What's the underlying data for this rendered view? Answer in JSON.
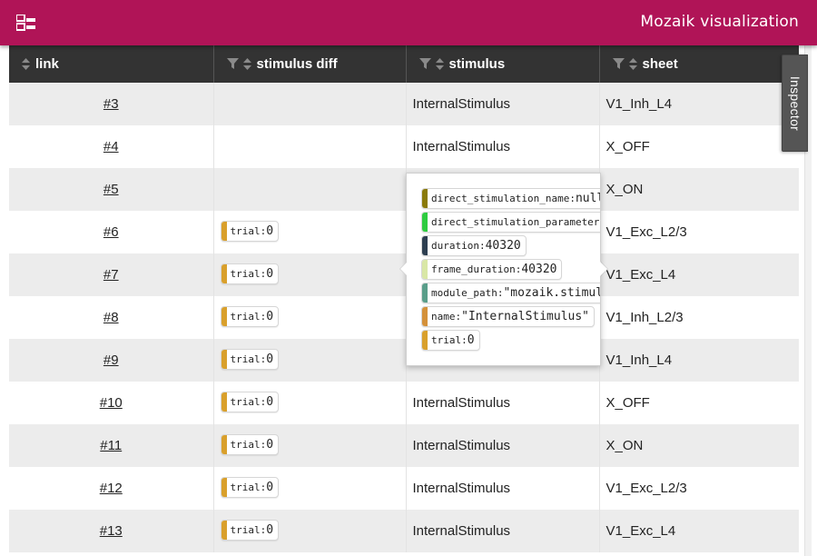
{
  "header": {
    "title": "Mozaik visualization",
    "icon": "layout-tree-icon"
  },
  "colors": {
    "header_bg": "#b01457",
    "table_header_bg": "#333333",
    "row_alt": "#ececec"
  },
  "inspector": {
    "label": "Inspector"
  },
  "columns": [
    {
      "label": "link",
      "filter": false
    },
    {
      "label": "stimulus diff",
      "filter": true
    },
    {
      "label": "stimulus",
      "filter": true
    },
    {
      "label": "sheet",
      "filter": true
    }
  ],
  "rows": [
    {
      "link": "#3",
      "diff": null,
      "stimulus": "InternalStimulus",
      "sheet": "V1_Inh_L4"
    },
    {
      "link": "#4",
      "diff": null,
      "stimulus": "InternalStimulus",
      "sheet": "X_OFF"
    },
    {
      "link": "#5",
      "diff": null,
      "stimulus": "",
      "sheet": "X_ON"
    },
    {
      "link": "#6",
      "diff": {
        "key": "trial:",
        "value": "0"
      },
      "stimulus": "",
      "sheet": "V1_Exc_L2/3"
    },
    {
      "link": "#7",
      "diff": {
        "key": "trial:",
        "value": "0"
      },
      "stimulus": "",
      "sheet": "V1_Exc_L4"
    },
    {
      "link": "#8",
      "diff": {
        "key": "trial:",
        "value": "0"
      },
      "stimulus": "",
      "sheet": "V1_Inh_L2/3"
    },
    {
      "link": "#9",
      "diff": {
        "key": "trial:",
        "value": "0"
      },
      "stimulus": "",
      "sheet": "V1_Inh_L4"
    },
    {
      "link": "#10",
      "diff": {
        "key": "trial:",
        "value": "0"
      },
      "stimulus": "InternalStimulus",
      "sheet": "X_OFF"
    },
    {
      "link": "#11",
      "diff": {
        "key": "trial:",
        "value": "0"
      },
      "stimulus": "InternalStimulus",
      "sheet": "X_ON"
    },
    {
      "link": "#12",
      "diff": {
        "key": "trial:",
        "value": "0"
      },
      "stimulus": "InternalStimulus",
      "sheet": "V1_Exc_L2/3"
    },
    {
      "link": "#13",
      "diff": {
        "key": "trial:",
        "value": "0"
      },
      "stimulus": "InternalStimulus",
      "sheet": "V1_Exc_L4"
    }
  ],
  "popup": {
    "items": [
      {
        "key": "direct_stimulation_name:",
        "value": "null",
        "color": "#8a7a0a"
      },
      {
        "key": "direct_stimulation_parameters:",
        "value": "",
        "color": "#2ecc40"
      },
      {
        "key": "duration:",
        "value": "40320",
        "color": "#2d3e50"
      },
      {
        "key": "frame_duration:",
        "value": "40320",
        "color": "#d9e7a6"
      },
      {
        "key": "module_path:",
        "value": "\"mozaik.stimuli\"",
        "color": "#5a9e8a"
      },
      {
        "key": "name:",
        "value": "\"InternalStimulus\"",
        "color": "#d4913a"
      },
      {
        "key": "trial:",
        "value": "0",
        "color": "#d9a02c"
      }
    ]
  },
  "trial_color": "#d9a02c"
}
